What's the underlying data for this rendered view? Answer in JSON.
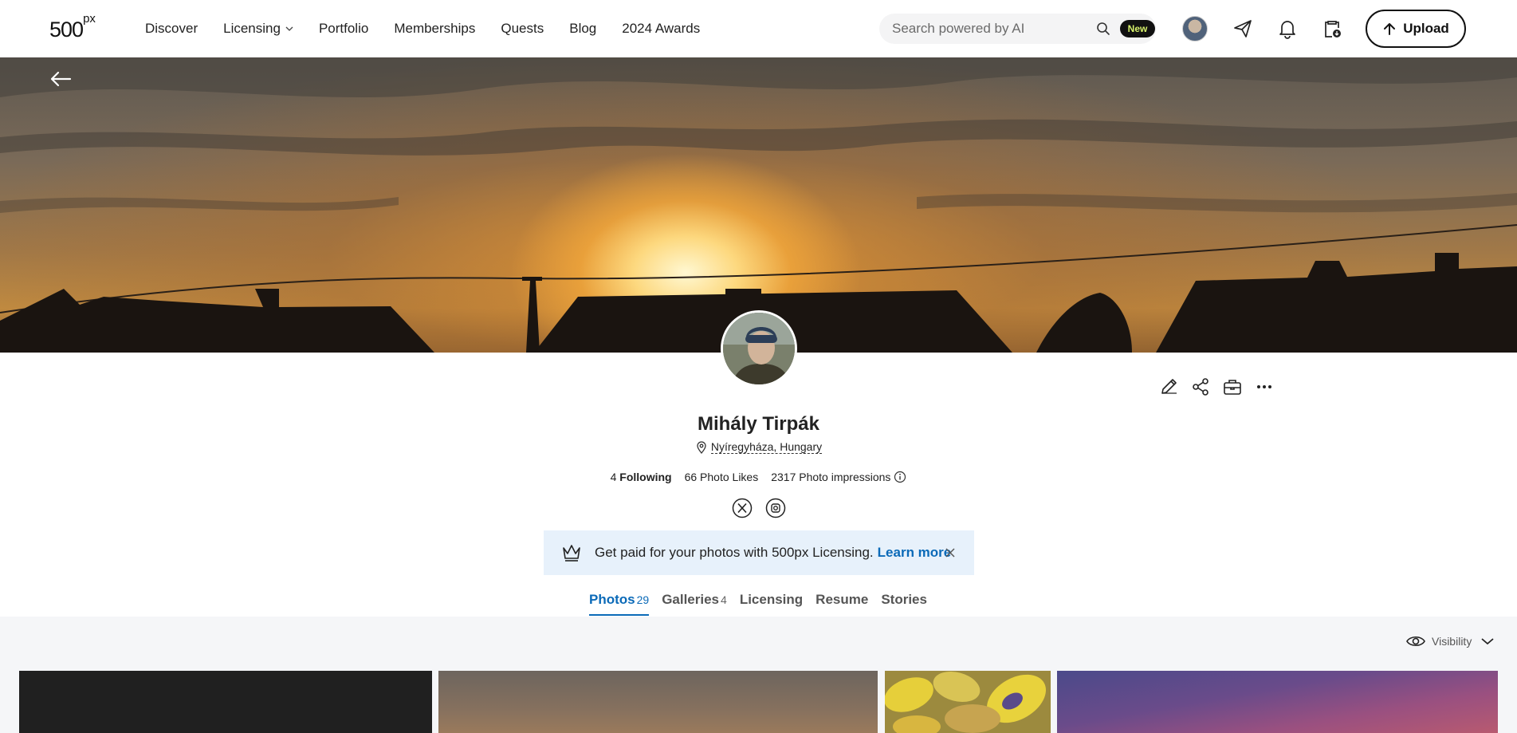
{
  "header": {
    "logo_text": "500",
    "logo_sup": "px",
    "nav": [
      {
        "label": "Discover"
      },
      {
        "label": "Licensing"
      },
      {
        "label": "Portfolio"
      },
      {
        "label": "Memberships"
      },
      {
        "label": "Quests"
      },
      {
        "label": "Blog"
      },
      {
        "label": "2024 Awards"
      }
    ],
    "search_placeholder": "Search powered by AI",
    "new_badge": "New",
    "upload_label": "Upload"
  },
  "profile": {
    "name": "Mihály Tirpák",
    "location": "Nyíregyháza, Hungary",
    "following_count": "4",
    "following_label": "Following",
    "photo_likes": "66 Photo Likes",
    "photo_impressions": "2317 Photo impressions"
  },
  "banner": {
    "text": "Get paid for your photos with 500px Licensing.",
    "link": "Learn more"
  },
  "tabs": [
    {
      "label": "Photos",
      "count": "29",
      "active": true
    },
    {
      "label": "Galleries",
      "count": "4"
    },
    {
      "label": "Licensing",
      "count": ""
    },
    {
      "label": "Resume",
      "count": ""
    },
    {
      "label": "Stories",
      "count": ""
    }
  ],
  "gallery": {
    "visibility_label": "Visibility"
  },
  "colors": {
    "accent_blue": "#0b6ab8",
    "banner_bg": "#e7f1fb",
    "badge_text": "#d7f26b"
  }
}
